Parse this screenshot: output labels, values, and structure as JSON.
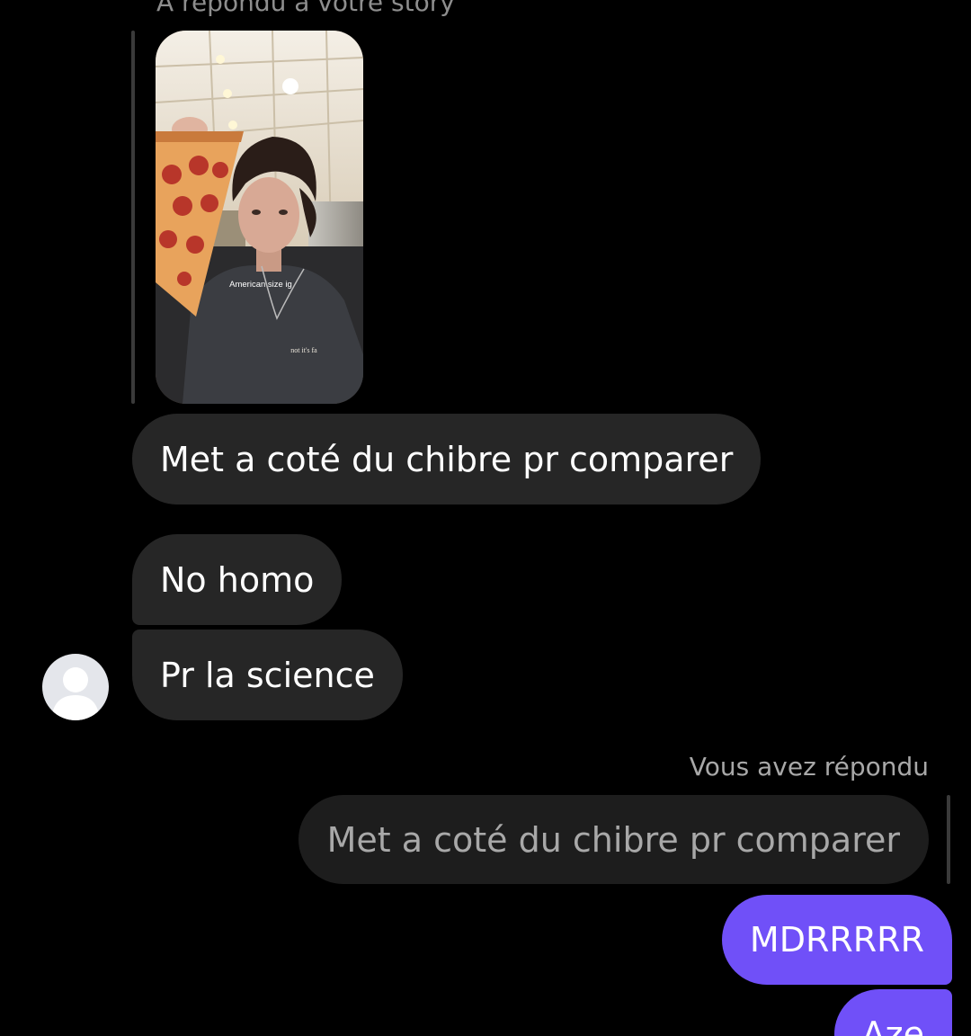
{
  "story_reply": {
    "caption": "A répondu à votre story",
    "story_overlay_text": "American size ig",
    "story_shirt_text": "not it's fa"
  },
  "incoming_messages": [
    "Met a coté du chibre pr comparer",
    "No homo",
    "Pr la science"
  ],
  "contact": {
    "avatar_icon": "default-avatar-icon"
  },
  "my_reply": {
    "caption": "Vous avez répondu",
    "quoted_text": "Met a coté du chibre pr comparer"
  },
  "outgoing_messages": [
    "MDRRRRR",
    "Aze"
  ],
  "colors": {
    "background": "#000000",
    "incoming_bubble": "#262626",
    "quoted_bubble": "#1d1d1d",
    "outgoing_bubble": "#7050f8",
    "secondary_text": "#8e8e8e"
  }
}
